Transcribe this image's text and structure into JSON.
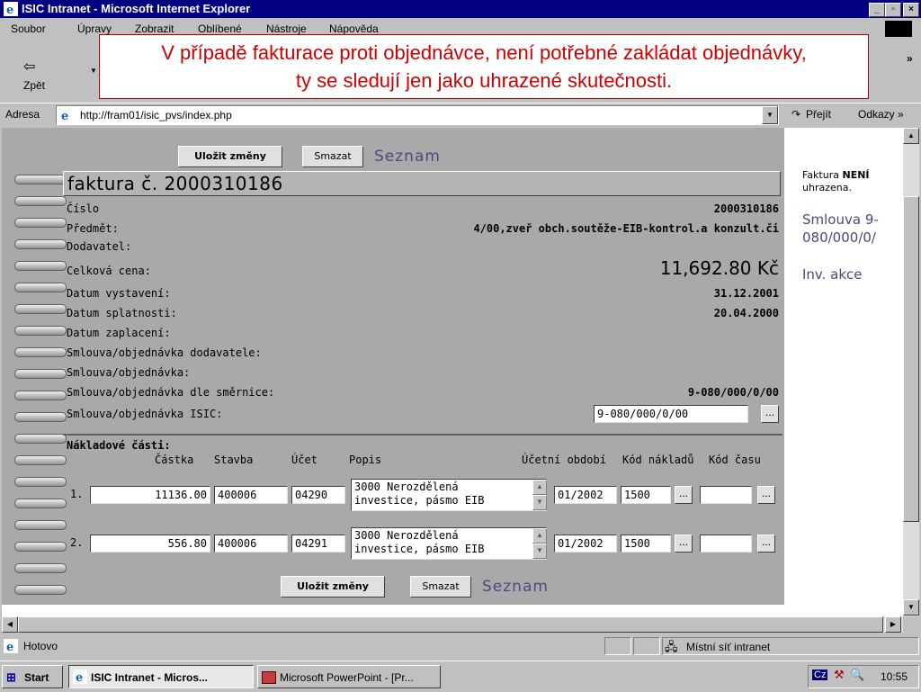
{
  "window": {
    "title": "ISIC Intranet - Microsoft Internet Explorer"
  },
  "menu": {
    "items": [
      "Soubor",
      "Úpravy",
      "Zobrazit",
      "Oblíbené",
      "Nástroje",
      "Nápověda"
    ]
  },
  "toolbar": {
    "back_label": "Zpět"
  },
  "address": {
    "label": "Adresa",
    "url": "http://fram01/isic_pvs/index.php",
    "go_label": "Přejít",
    "links_label": "Odkazy »"
  },
  "annotation": {
    "line1": "V případě fakturace proti objednávce, není potřebné zakládat objednávky,",
    "line2": "ty se sledují jen jako uhrazené skutečnosti."
  },
  "actions": {
    "save_label": "Uložit změny",
    "delete_label": "Smazat",
    "list_label": "Seznam"
  },
  "invoice": {
    "title": "faktura č. 2000310186",
    "fields": [
      {
        "label": "Číslo",
        "value": "2000310186"
      },
      {
        "label": "Předmět:",
        "value": "4/00,zveř obch.soutěže-EIB-kontrol.a konzult.či"
      },
      {
        "label": "Dodavatel:",
        "value": ""
      },
      {
        "label": "Celková cena:",
        "value": "11,692.80 Kč"
      },
      {
        "label": "Datum vystavení:",
        "value": "31.12.2001"
      },
      {
        "label": "Datum splatnosti:",
        "value": "20.04.2000"
      },
      {
        "label": "Datum zaplacení:",
        "value": ""
      },
      {
        "label": "Smlouva/objednávka dodavatele:",
        "value": ""
      },
      {
        "label": "Smlouva/objednávka:",
        "value": ""
      },
      {
        "label": "Smlouva/objednávka dle směrnice:",
        "value": "9-080/000/0/00"
      }
    ],
    "isic_label": "Smlouva/objednávka ISIC:",
    "isic_value": "9-080/000/0/00",
    "dots": "..."
  },
  "costs": {
    "title": "Nákladové části:",
    "headers": {
      "amount": "Částka",
      "building": "Stavba",
      "account": "Účet",
      "description": "Popis",
      "period": "Účetní období",
      "cost_code": "Kód nákladů",
      "time_code": "Kód času"
    },
    "rows": [
      {
        "num": "1.",
        "amount": "11136.00",
        "building": "400006",
        "account": "04290",
        "desc1": "3000 Nerozdělená",
        "desc2": "investice, pásmo EIB",
        "period": "01/2002",
        "cost_code": "1500",
        "time_code": ""
      },
      {
        "num": "2.",
        "amount": "556.80",
        "building": "400006",
        "account": "04291",
        "desc1": "3000 Nerozdělená",
        "desc2": "investice, pásmo EIB",
        "period": "01/2002",
        "cost_code": "1500",
        "time_code": ""
      }
    ]
  },
  "sidebar": {
    "status_pre": "Faktura ",
    "status_bold": "NENÍ",
    "status_post": "uhrazena.",
    "contract_line1": "Smlouva 9-",
    "contract_line2": "080/000/0/",
    "inv_label": "Inv. akce"
  },
  "statusbar": {
    "text": "Hotovo",
    "zone": "Místní síť intranet"
  },
  "taskbar": {
    "start": "Start",
    "task1": "ISIC Intranet - Micros...",
    "task2": "Microsoft PowerPoint - [Pr...",
    "lang": "Cz",
    "clock": "10:55"
  }
}
